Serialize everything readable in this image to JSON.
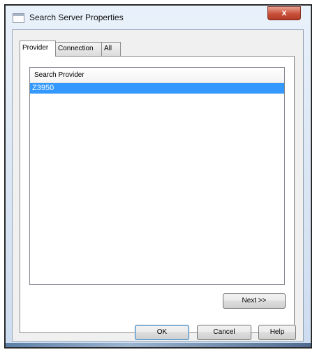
{
  "window": {
    "title": "Search Server Properties",
    "close_label": "x"
  },
  "tabs": [
    {
      "label": "Provider",
      "active": true
    },
    {
      "label": "Connection",
      "active": false
    },
    {
      "label": "All",
      "active": false
    }
  ],
  "provider_list": {
    "column_header": "Search Provider",
    "rows": [
      {
        "label": "Z3950",
        "selected": true
      }
    ]
  },
  "buttons": {
    "next": "Next >>",
    "ok": "OK",
    "cancel": "Cancel",
    "help": "Help"
  },
  "colors": {
    "selection": "#3399ff",
    "close_button": "#c9503a"
  }
}
